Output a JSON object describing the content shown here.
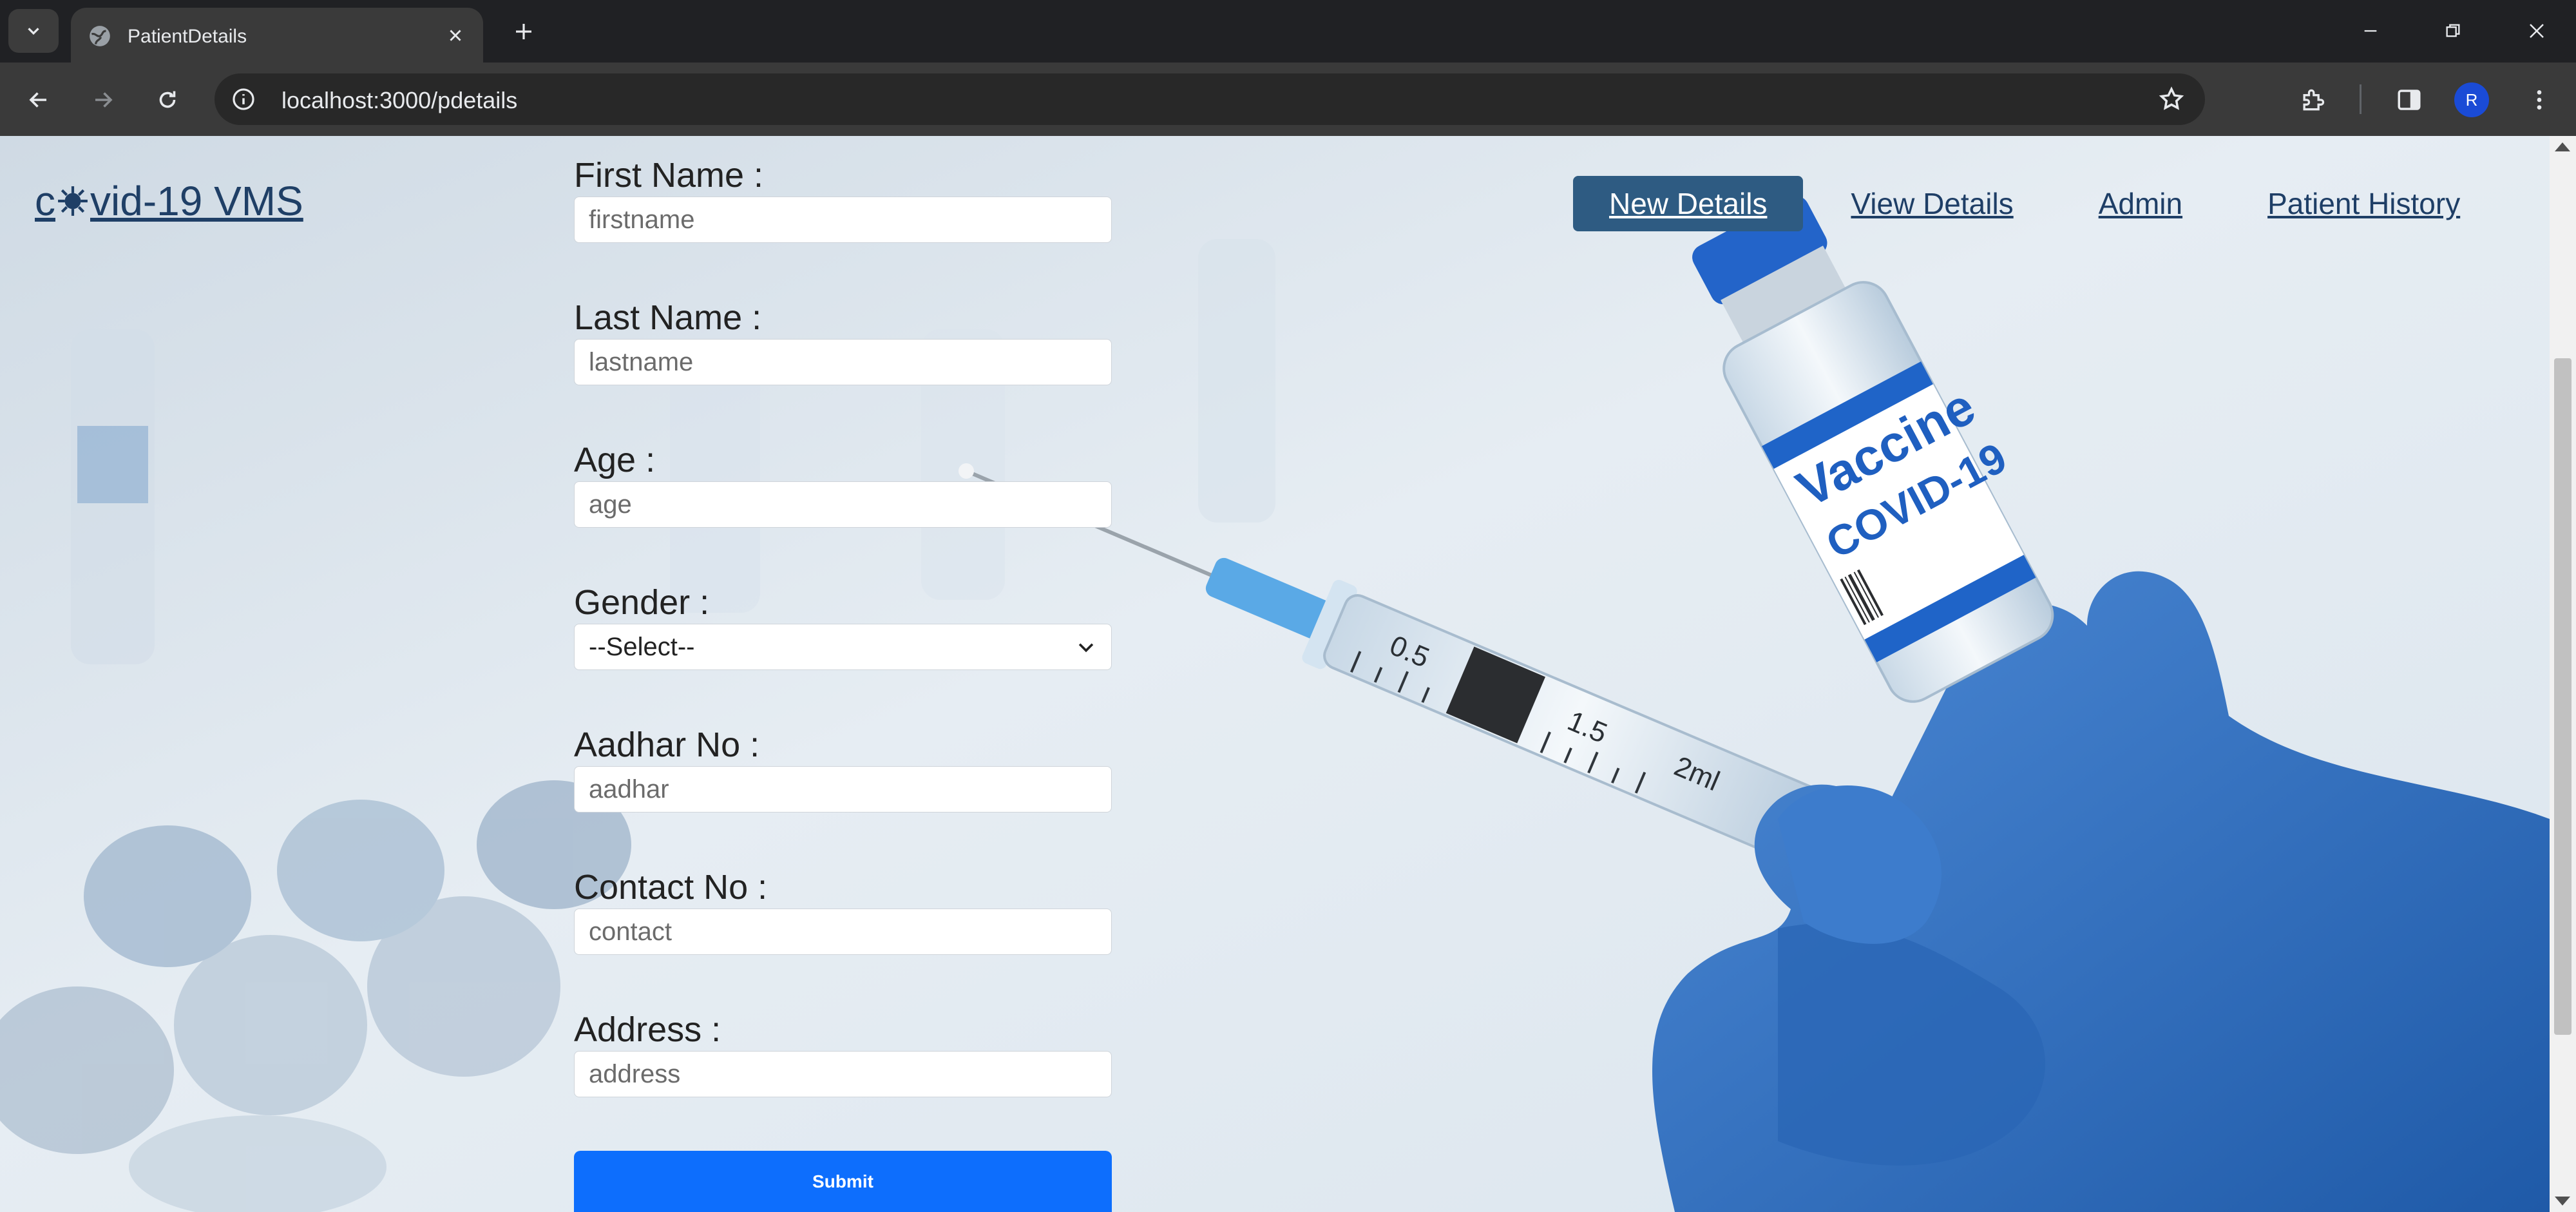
{
  "browser": {
    "tab_title": "PatientDetails",
    "url": "localhost:3000/pdetails",
    "profile_initial": "R"
  },
  "page": {
    "logo_text_before": "c",
    "logo_text_after": "vid-19 VMS",
    "nav": [
      {
        "label": "New Details",
        "active": true
      },
      {
        "label": "View Details",
        "active": false
      },
      {
        "label": "Admin",
        "active": false
      },
      {
        "label": "Patient History",
        "active": false
      }
    ],
    "form": {
      "first_name_label": "First Name :",
      "first_name_placeholder": "firstname",
      "last_name_label": "Last Name :",
      "last_name_placeholder": "lastname",
      "age_label": "Age :",
      "age_placeholder": "age",
      "gender_label": "Gender :",
      "gender_selected": "--Select--",
      "aadhar_label": "Aadhar No :",
      "aadhar_placeholder": "aadhar",
      "contact_label": "Contact No :",
      "contact_placeholder": "contact",
      "address_label": "Address :",
      "address_placeholder": "address",
      "submit_label": "Submit"
    },
    "vial_text": [
      "Vaccine",
      "COVID-19"
    ],
    "syringe_marks": [
      "0.5",
      "1.5",
      "2ml"
    ]
  },
  "colors": {
    "accent_button": "#0d6efd",
    "nav_active": "#2e5b82",
    "glove": "#2f6fc0"
  }
}
